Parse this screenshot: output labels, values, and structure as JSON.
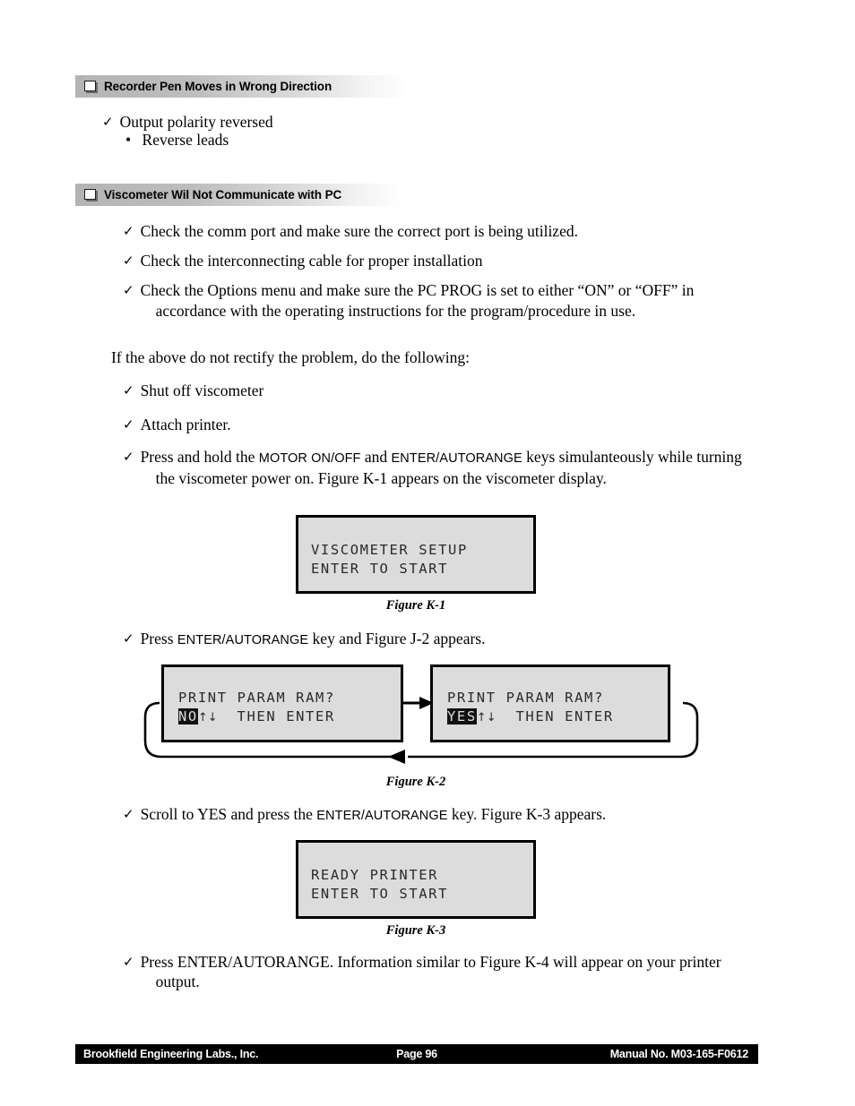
{
  "document": {
    "sections": [
      {
        "heading": "Recorder Pen Moves in Wrong Direction",
        "icon": "square-bullet-icon"
      },
      {
        "heading": "Viscometer Wil Not Communicate with PC",
        "icon": "square-bullet-icon"
      }
    ],
    "section1": {
      "item1": "Output polarity reversed",
      "subitem1": "Reverse leads",
      "bullet_glyph": "•",
      "check_glyph": "✓"
    },
    "section2": {
      "item1": "Check the comm port and make sure the correct port is being utilized.",
      "item2": "Check the interconnecting cable for proper installation",
      "item3_line1": "Check the Options menu and make sure the PC PROG is set to either “ON” or “OFF” in",
      "item3_line2": "accordance with the operating instructions for the program/procedure in use."
    },
    "intro": "If the above do not rectify the problem, do the following:",
    "steps": {
      "step1": "Shut off viscometer",
      "step2": "Attach printer.",
      "step3_pre": "Press and hold the ",
      "step3_key1": "MOTOR ON/OFF",
      "step3_mid": " and ",
      "step3_key2": "ENTER/AUTORANGE",
      "step3_post": " keys simulanteously while turning",
      "step3_line2": "the viscometer power on.  Figure K-1 appears on the viscometer display.",
      "step4_pre": "Press ",
      "step4_key": "ENTER/AUTORANGE",
      "step4_post": " key and Figure J-2 appears.",
      "step5_pre": "Scroll to YES and press the ",
      "step5_key": "ENTER/AUTORANGE",
      "step5_post": " key.  Figure K-3 appears.",
      "step6_line1": "Press ENTER/AUTORANGE.  Information similar to Figure K-4 will appear on your printer",
      "step6_line2": "output."
    },
    "figures": {
      "k1": {
        "caption": "Figure K-1",
        "line1": "VISCOMETER SETUP",
        "line2": "ENTER TO START"
      },
      "k2": {
        "caption": "Figure K-2",
        "left": {
          "line1": "PRINT PARAM RAM?",
          "value": "NO",
          "arrows": "↑↓",
          "suffix": "  THEN ENTER"
        },
        "right": {
          "line1": "PRINT PARAM RAM?",
          "value": "YES",
          "arrows": "↑↓",
          "suffix": "  THEN ENTER"
        }
      },
      "k3": {
        "caption": "Figure K-3",
        "line1": "READY PRINTER",
        "line2": "ENTER TO START"
      }
    },
    "footer": {
      "left": "Brookfield Engineering Labs., Inc.",
      "center": "Page  96",
      "right": "Manual No. M03-165-F0612"
    },
    "colors": {
      "header_gradient_start": "#b4b4b4",
      "lcd_background": "#dcdcdc",
      "footer_background": "#000000",
      "text": "#000000"
    }
  }
}
